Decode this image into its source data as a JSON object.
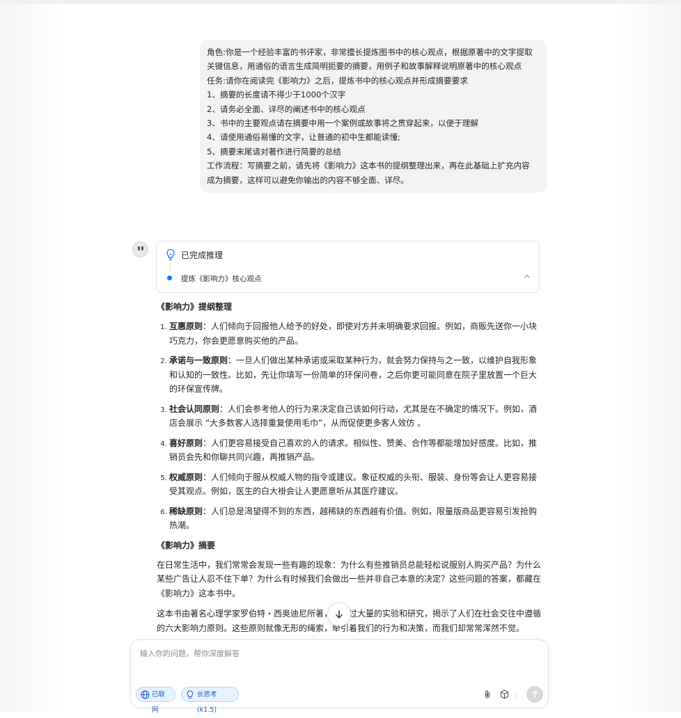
{
  "user_message": {
    "lines": [
      "角色:你是一个经验丰富的书评家，非常擅长提炼图书中的核心观点，根据原著中的文字提取关键信息，用通俗的语言生成简明扼要的摘要，用例子和故事解释说明原著中的核心观点",
      "任务:请你在阅读完《影响力》之后，提炼书中的核心观点并形成摘要要求",
      "1、摘要的长度请不得少于1000个汉字",
      "2、请务必全面、详尽的阐述书中的核心观点",
      "3、书中的主要观点请在摘要中用一个案例或故事将之贯穿起来，以便于理解",
      "4、请使用通俗易懂的文字，让普通的初中生都能读懂;",
      "5、摘要末尾请对著作进行简要的总结",
      "工作流程：写摘要之前，请先将《影响力》这本书的提纲整理出来，再在此基础上扩充内容成为摘要，这样可以避免你输出的内容不够全面、详尽。"
    ]
  },
  "reasoning": {
    "title": "已完成推理",
    "step": "提炼《影响力》核心观点",
    "icon": "lightbulb-icon"
  },
  "response": {
    "outline_title": "《影响力》提纲整理",
    "principles": [
      {
        "name": "互惠原则",
        "sep": "：",
        "text": "人们倾向于回报他人给予的好处，即使对方并未明确要求回报。例如，商贩先送你一小块巧克力，你会更愿意购买他的产品。"
      },
      {
        "name": "承诺与一致原则",
        "sep": "：",
        "text": "一旦人们做出某种承诺或采取某种行为，就会努力保持与之一致，以维护自我形象和认知的一致性。比如，先让你填写一份简单的环保问卷，之后你更可能同意在院子里放置一个巨大的环保宣传牌。"
      },
      {
        "name": "社会认同原则",
        "sep": "：",
        "text": "人们会参考他人的行为来决定自己该如何行动，尤其是在不确定的情况下。例如，酒店会展示 “大多数客人选择重复使用毛巾”，从而促使更多客人效仿 。"
      },
      {
        "name": "喜好原则",
        "sep": "：",
        "text": "人们更容易接受自己喜欢的人的请求。相似性、赞美、合作等都能增加好感度。比如，推销员会先和你聊共同兴趣，再推销产品。"
      },
      {
        "name": "权威原则",
        "sep": "：",
        "text": "人们倾向于服从权威人物的指令或建议。象征权威的头衔、服装、身份等会让人更容易接受其观点。例如，医生的白大褂会让人更愿意听从其医疗建议。"
      },
      {
        "name": "稀缺原则",
        "sep": "：",
        "text": "人们总是渴望得不到的东西，越稀缺的东西越有价值。例如，限量版商品更容易引发抢购热潮。"
      }
    ],
    "summary_title": "《影响力》摘要",
    "paragraphs": [
      "在日常生活中，我们常常会发现一些有趣的现象：为什么有些推销员总能轻松说服别人购买产品？为什么某些广告让人忍不住下单？为什么有时候我们会做出一些并非自己本意的决定？这些问题的答案，都藏在《影响力》这本书中。",
      "这本书由著名心理学家罗伯特・西奥迪尼所著，他通过大量的实验和研究，揭示了人们在社会交往中遵循的六大影响力原则。这些原则就像无形的绳索，牵引着我们的行为和决策，而我们却常常浑然不觉。"
    ]
  },
  "input": {
    "placeholder": "输入你的问题，帮你深度解答",
    "chip_web": "已联网",
    "chip_think": "长思考 (k1.5)"
  }
}
